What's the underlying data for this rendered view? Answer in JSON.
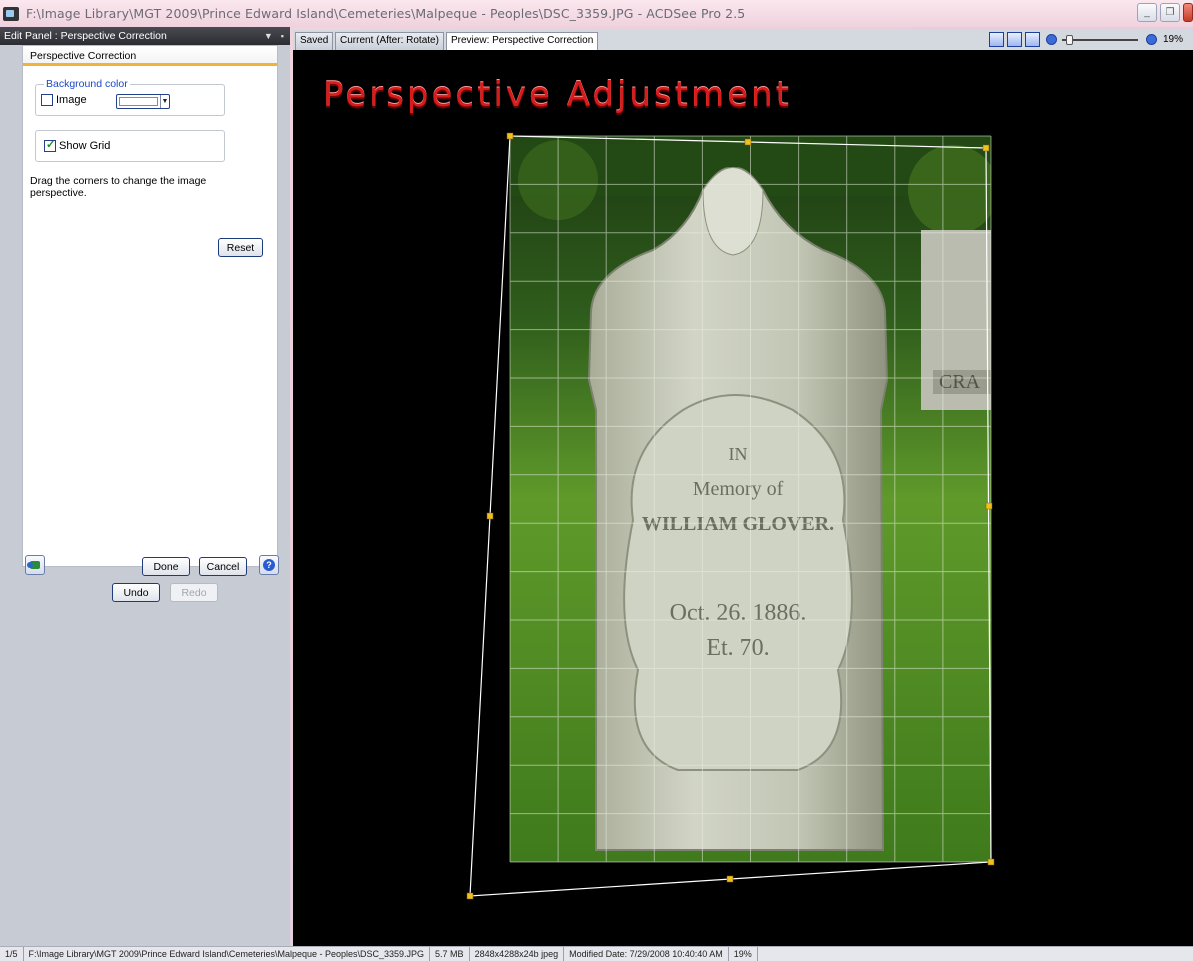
{
  "window": {
    "title": "F:\\Image Library\\MGT 2009\\Prince Edward Island\\Cemeteries\\Malpeque - Peoples\\DSC_3359.JPG - ACDSee Pro 2.5"
  },
  "edit_panel": {
    "header": "Edit Panel : Perspective Correction",
    "tab": "Perspective Correction",
    "background_group": {
      "legend": "Background color",
      "image_label": "Image",
      "image_checked": false,
      "color": "#ffffff"
    },
    "show_grid": {
      "label": "Show Grid",
      "checked": true
    },
    "help_text": "Drag the corners to change the image perspective.",
    "reset_label": "Reset",
    "done_label": "Done",
    "cancel_label": "Cancel",
    "undo_label": "Undo",
    "redo_label": "Redo"
  },
  "preview": {
    "tabs": [
      "Saved",
      "Current (After: Rotate)",
      "Preview: Perspective Correction"
    ],
    "active_tab": "Preview: Perspective Correction",
    "zoom": "19%",
    "heading": "Perspective Adjustment",
    "headstone_text": [
      "IN",
      "Memory of",
      "WILLIAM GLOVER.",
      "Oct. 26. 1886.",
      "Et. 70."
    ],
    "neighbor_stone_text": "CRA"
  },
  "statusbar": {
    "position": "1/5",
    "path": "F:\\Image Library\\MGT 2009\\Prince Edward Island\\Cemeteries\\Malpeque - Peoples\\DSC_3359.JPG",
    "size": "5.7 MB",
    "dims": "2848x4288x24b jpeg",
    "modified": "Modified Date: 7/29/2008 10:40:40 AM",
    "zoom": "19%"
  },
  "colors": {
    "accent_tab": "#f0b338",
    "heading_red": "#d71c1c",
    "handle": "#f0c020",
    "legend_blue": "#1c48c9"
  }
}
